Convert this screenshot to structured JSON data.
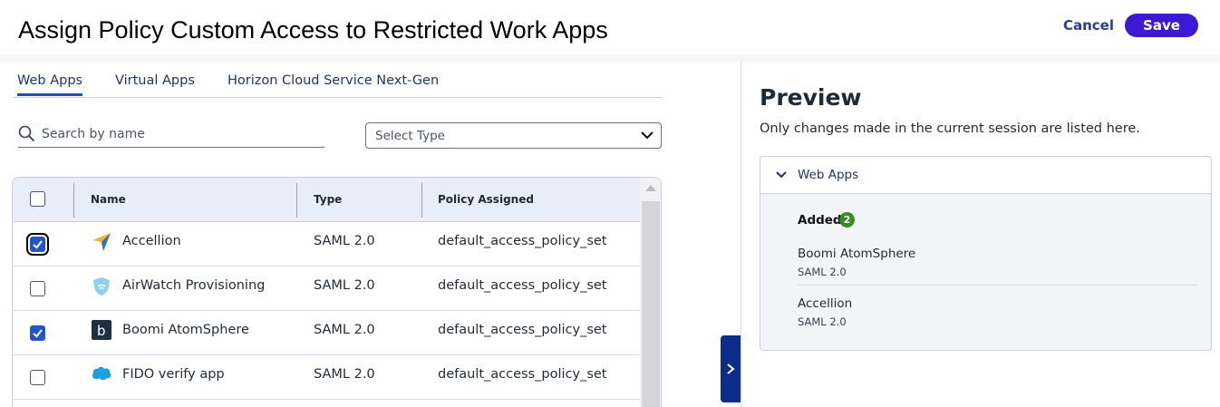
{
  "header": {
    "title": "Assign Policy Custom Access to Restricted Work Apps",
    "cancel_label": "Cancel",
    "save_label": "Save"
  },
  "tabs": [
    {
      "label": "Web Apps",
      "active": true
    },
    {
      "label": "Virtual Apps",
      "active": false
    },
    {
      "label": "Horizon Cloud Service Next-Gen",
      "active": false
    }
  ],
  "filters": {
    "search_placeholder": "Search by name",
    "type_select_value": "Select Type"
  },
  "table": {
    "columns": [
      "Name",
      "Type",
      "Policy Assigned"
    ],
    "rows": [
      {
        "name": "Accellion",
        "type": "SAML 2.0",
        "policy": "default_access_policy_set",
        "checked": true,
        "icon": "accellion-icon"
      },
      {
        "name": "AirWatch Provisioning",
        "type": "SAML 2.0",
        "policy": "default_access_policy_set",
        "checked": false,
        "icon": "airwatch-shield-icon"
      },
      {
        "name": "Boomi AtomSphere",
        "type": "SAML 2.0",
        "policy": "default_access_policy_set",
        "checked": true,
        "icon": "boomi-icon"
      },
      {
        "name": "FIDO verify app",
        "type": "SAML 2.0",
        "policy": "default_access_policy_set",
        "checked": false,
        "icon": "salesforce-cloud-icon"
      }
    ]
  },
  "preview": {
    "title": "Preview",
    "subtitle": "Only changes made in the current session are listed here.",
    "section_label": "Web Apps",
    "added_label": "Added",
    "added_count": "2",
    "items": [
      {
        "name": "Boomi AtomSphere",
        "type": "SAML 2.0"
      },
      {
        "name": "Accellion",
        "type": "SAML 2.0"
      }
    ]
  },
  "colors": {
    "primary": "#3d19d6",
    "nav_blue": "#0d2c8c",
    "checkbox_checked": "#2256c7",
    "badge_green": "#3b8a21",
    "table_header": "#e8edfa"
  }
}
